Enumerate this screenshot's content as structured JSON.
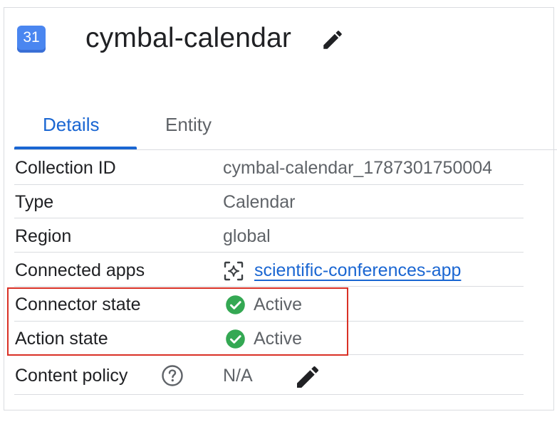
{
  "header": {
    "icon_label": "31",
    "icon_name": "google-calendar-icon",
    "title": "cymbal-calendar",
    "edit_icon": "pencil-icon"
  },
  "tabs": [
    {
      "label": "Details",
      "active": true
    },
    {
      "label": "Entity",
      "active": false
    }
  ],
  "details": {
    "collection_id": {
      "label": "Collection ID",
      "value": "cymbal-calendar_1787301750004"
    },
    "type": {
      "label": "Type",
      "value": "Calendar"
    },
    "region": {
      "label": "Region",
      "value": "global"
    },
    "connected_apps": {
      "label": "Connected apps",
      "value": "scientific-conferences-app",
      "icon": "sparkle-app-icon"
    },
    "connector_state": {
      "label": "Connector state",
      "value": "Active",
      "icon": "check-circle-icon"
    },
    "action_state": {
      "label": "Action state",
      "value": "Active",
      "icon": "check-circle-icon"
    },
    "content_policy": {
      "label": "Content policy",
      "value": "N/A",
      "help_icon": "help-icon",
      "edit_icon": "pencil-icon"
    }
  },
  "colors": {
    "accent": "#1a66d2",
    "success": "#34a853",
    "highlight": "#d93025",
    "calendar_icon": "#4a86f0"
  }
}
